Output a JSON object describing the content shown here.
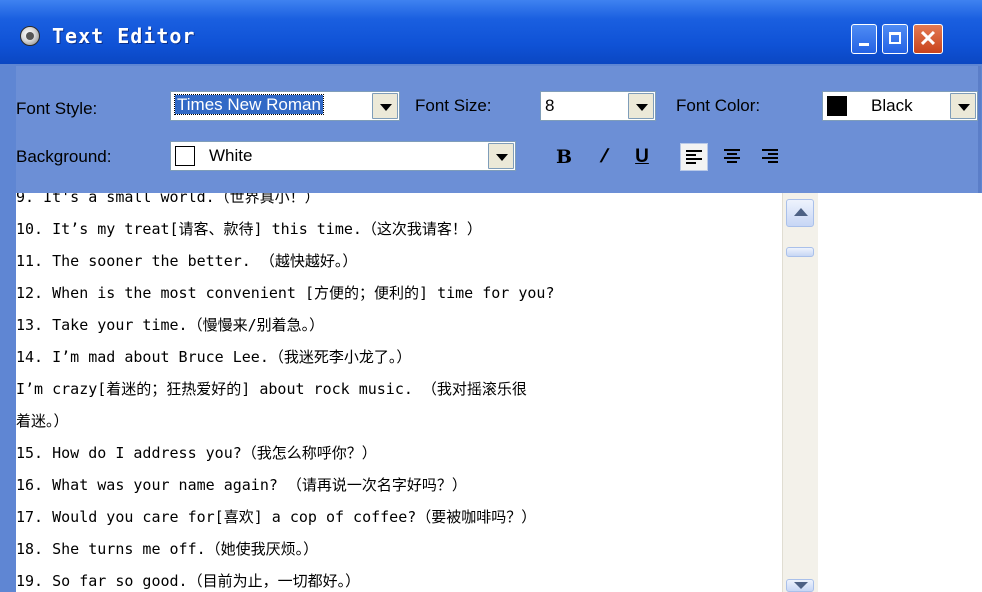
{
  "window": {
    "title": "Text Editor",
    "colors": {
      "titlebar": "#0f52d6",
      "toolbar": "#6c8fd6",
      "close_button": "#c9431d"
    }
  },
  "toolbar": {
    "font_style_label": "Font Style:",
    "font_style_value": "Times New Roman",
    "font_size_label": "Font Size:",
    "font_size_value": "8",
    "font_color_label": "Font Color:",
    "font_color_value": "Black",
    "font_color_swatch": "#000000",
    "background_label": "Background:",
    "background_value": "White",
    "background_swatch": "#ffffff",
    "bold_glyph": "B",
    "italic_glyph": "/",
    "underline_glyph": "U",
    "align_left_icon": "align-left-icon",
    "align_center_icon": "align-center-icon",
    "align_right_icon": "align-right-icon"
  },
  "editor": {
    "lines": [
      "9. It's a small world.（世界真小！）",
      "10. It’s my treat[请客、款待] this time.（这次我请客！）",
      "11. The sooner the better. （越快越好。）",
      "12. When is the most convenient [方便的；便利的] time for you?",
      "13. Take your time.（慢慢来/别着急。）",
      "14. I’m mad about Bruce Lee.（我迷死李小龙了。）",
      "I’m crazy[着迷的；狂热爱好的] about rock music. （我对摇滚乐很",
      "着迷。）",
      "15. How do I address you?（我怎么称呼你？）",
      "16. What was your name again? （请再说一次名字好吗？）",
      "17. Would you care for[喜欢] a cop of coffee?（要被咖啡吗？）",
      "18. She turns me off.（她使我厌烦。）",
      "19. So far so good.（目前为止，一切都好。）"
    ]
  }
}
